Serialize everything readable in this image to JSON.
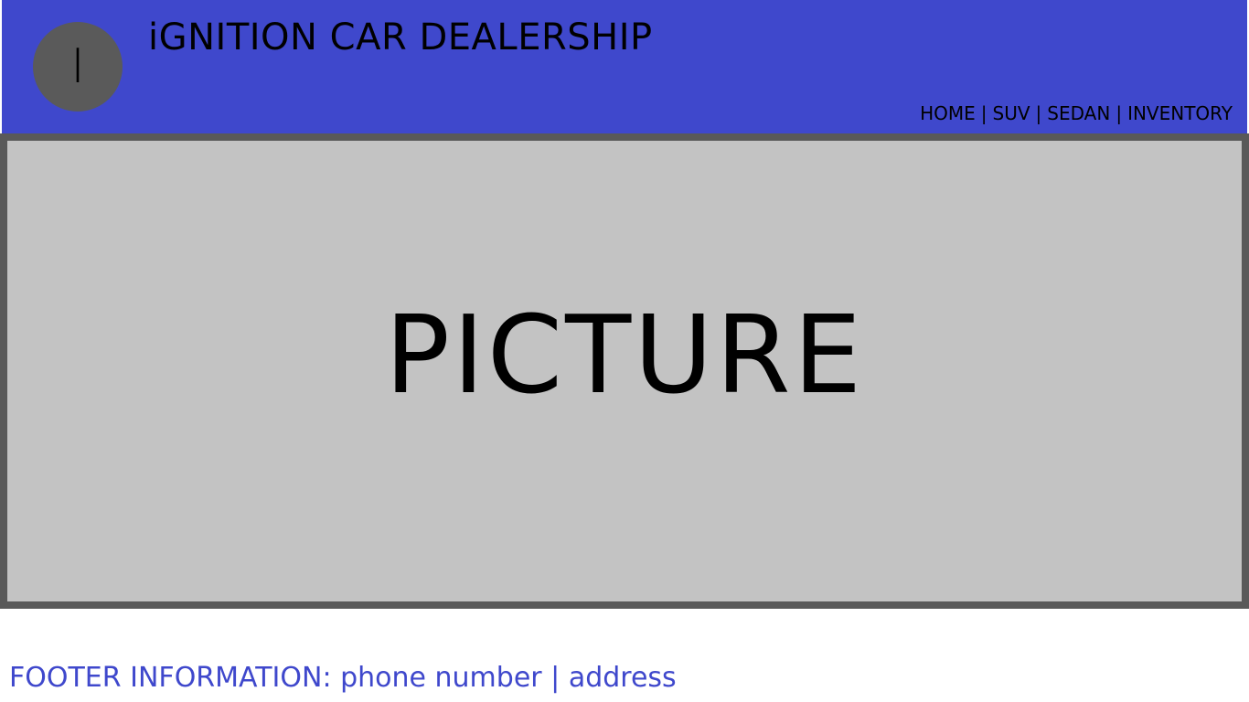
{
  "header": {
    "logo_letter": "I",
    "site_title": "iGNITION CAR DEALERSHIP",
    "nav": {
      "items": [
        "HOME",
        "SUV",
        "SEDAN",
        "INVENTORY"
      ],
      "separator": "|"
    }
  },
  "hero": {
    "placeholder_text": "PICTURE"
  },
  "footer": {
    "label": "FOOTER INFORMATION:",
    "phone": "phone number",
    "separator": "|",
    "address": "address"
  },
  "colors": {
    "header_bg": "#3f48cc",
    "logo_bg": "#5a5a5a",
    "hero_bg": "#c3c3c3",
    "hero_border": "#595959",
    "footer_text": "#3f48cc"
  }
}
